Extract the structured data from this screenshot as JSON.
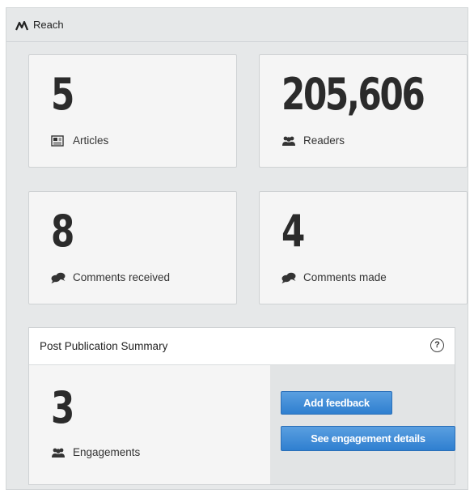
{
  "reach": {
    "title": "Reach",
    "icon": "reach-chart-icon"
  },
  "stats": {
    "articles": {
      "value": "5",
      "label": "Articles",
      "icon": "article-icon"
    },
    "readers": {
      "value": "205,606",
      "label": "Readers",
      "icon": "people-icon"
    },
    "comments_received": {
      "value": "8",
      "label": "Comments received",
      "icon": "comments-icon"
    },
    "comments_made": {
      "value": "4",
      "label": "Comments made",
      "icon": "comments-icon"
    }
  },
  "post_publication_summary": {
    "title": "Post Publication Summary",
    "help_symbol": "?",
    "engagements": {
      "value": "3",
      "label": "Engagements",
      "icon": "people-icon"
    },
    "add_feedback_label": "Add feedback",
    "see_details_label": "See engagement details"
  },
  "colors": {
    "button_blue": "#3a88d6",
    "panel_bg": "#e6e8e9",
    "card_bg": "#f5f5f5"
  }
}
